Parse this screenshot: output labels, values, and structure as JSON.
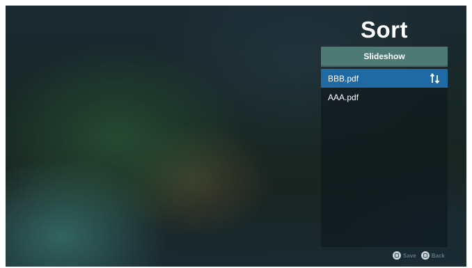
{
  "header": {
    "title": "Sort"
  },
  "mode": {
    "label": "Slideshow"
  },
  "files": [
    {
      "name": "BBB.pdf",
      "selected": true
    },
    {
      "name": "AAA.pdf",
      "selected": false
    }
  ],
  "footer": {
    "save_label": "Save",
    "back_label": "Back"
  },
  "icons": {
    "sort": "sort-arrows-icon",
    "save_key": "save-key-icon",
    "back_key": "back-key-icon"
  },
  "colors": {
    "accent_selected": "#1f6aa5",
    "mode_button": "#4d7a73"
  }
}
